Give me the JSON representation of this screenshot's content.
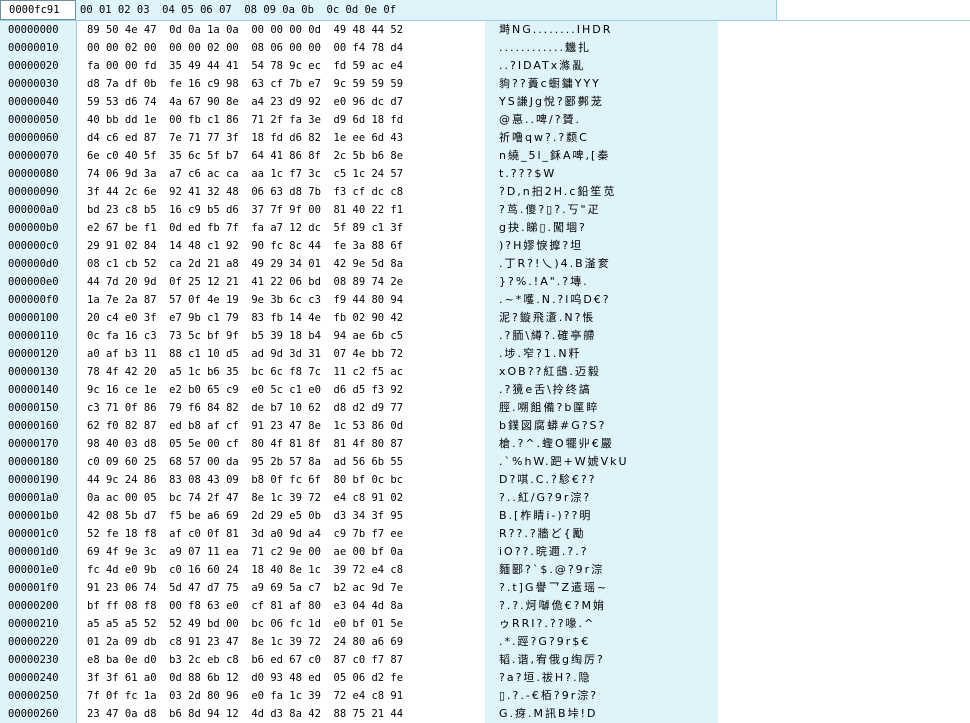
{
  "header": {
    "address": "0000fc91",
    "columns": "00 01 02 03  04 05 06 07  08 09 0a 0b  0c 0d 0e 0f"
  },
  "rows": [
    {
      "offset": "00000000",
      "hex": "89 50 4e 47  0d 0a 1a 0a  00 00 00 0d  49 48 44 52",
      "text": "塒NG........IHDR"
    },
    {
      "offset": "00000010",
      "hex": "00 00 02 00  00 00 02 00  08 06 00 00  00 f4 78 d4",
      "text": "............魕扎"
    },
    {
      "offset": "00000020",
      "hex": "fa 00 00 fd  35 49 44 41  54 78 9c ec  fd 59 ac e4",
      "text": "..?IDATx滌亂"
    },
    {
      "offset": "00000030",
      "hex": "d8 7a df 0b  fe 16 c9 98  63 cf 7b e7  9c 59 59 59",
      "text": "豿??蕢c蟵鏞YYY"
    },
    {
      "offset": "00000040",
      "hex": "59 53 d6 74  4a 67 90 8e  a4 23 d9 92  e0 96 dc d7",
      "text": "YS謙Jg悅?郾鄸茏"
    },
    {
      "offset": "00000050",
      "hex": "40 bb dd 1e  00 fb c1 86  71 2f fa 3e  d9 6d 18 fd",
      "text": "@惪..啤/?贇."
    },
    {
      "offset": "00000060",
      "hex": "d4 c6 ed 87  7e 71 77 3f  18 fd d6 82  1e ee 6d 43",
      "text": "祈噜qw?.?颣C"
    },
    {
      "offset": "00000070",
      "hex": "6e c0 40 5f  35 6c 5f b7  64 41 86 8f  2c 5b b6 8e",
      "text": "n繞_5l_鉌A啤,[秦"
    },
    {
      "offset": "00000080",
      "hex": "74 06 9d 3a  a7 c6 ac ca  aa 1c f7 3c  c5 1c 24 57",
      "text": "t.???$W"
    },
    {
      "offset": "00000090",
      "hex": "3f 44 2c 6e  92 41 32 48  06 63 d8 7b  f3 cf dc c8",
      "text": "?D,n抇2H.c鉛笙苋"
    },
    {
      "offset": "000000a0",
      "hex": "bd 23 c8 b5  16 c9 b5 d6  37 7f 9f 00  81 40 22 f1",
      "text": "?茑.傻?▯?.丂\"疋"
    },
    {
      "offset": "000000b0",
      "hex": "e2 67 be f1  0d ed fb 7f  fa a7 12 dc  5f 89 c1 3f",
      "text": "g抉.睇▯.闖堌?"
    },
    {
      "offset": "000000c0",
      "hex": "29 91 02 84  14 48 c1 92  90 fc 8c 44  fe 3a 88 6f",
      "text": ")?H嫪悷擵?坦"
    },
    {
      "offset": "000000d0",
      "hex": "08 c1 cb 52  ca 2d 21 a8  49 29 34 01  42 9e 5d 8a",
      "text": ".丁R?!乀)4.B滏奒"
    },
    {
      "offset": "000000e0",
      "hex": "44 7d 20 9d  0f 25 12 21  41 22 06 bd  08 89 74 2e",
      "text": "}?%.!A\".?塼."
    },
    {
      "offset": "000000f0",
      "hex": "1a 7e 2a 87  57 0f 4e 19  9e 3b 6c c3  f9 44 80 94",
      "text": ".~*嚄.N.?l呜D€?"
    },
    {
      "offset": "00000100",
      "hex": "20 c4 e0 3f  e7 9b c1 79  83 fb 14 4e  fb 02 90 42",
      "text": "泥?鏇飛濸.N?悵"
    },
    {
      "offset": "00000110",
      "hex": "0c fa 16 c3  73 5c bf 9f  b5 39 18 b4  94 ae 6b c5",
      "text": ".?胹\\繜?.確亭艜"
    },
    {
      "offset": "00000120",
      "hex": "a0 af b3 11  88 c1 10 d5  ad 9d 3d 31  07 4e bb 72",
      "text": ".埗.窄?1.N粁"
    },
    {
      "offset": "00000130",
      "hex": "78 4f 42 20  a5 1c b6 35  bc 6c f8 7c  11 c2 f5 ac",
      "text": "xOB??紅鴟.迈毅"
    },
    {
      "offset": "00000140",
      "hex": "9c 16 ce 1e  e2 b0 65 c9  e0 5c c1 e0  d6 d5 f3 92",
      "text": ".?獍e舌\\拎终謞"
    },
    {
      "offset": "00000150",
      "hex": "c3 71 0f 86  79 f6 84 82  de b7 10 62  d8 d2 d9 77",
      "text": "脛.嗍飷備?b匰睟"
    },
    {
      "offset": "00000160",
      "hex": "62 f0 82 87  ed b8 af cf  91 23 47 8e  1c 53 86 0d",
      "text": "b鏷図腐蟒#G?S?"
    },
    {
      "offset": "00000170",
      "hex": "98 40 03 d8  05 5e 00 cf  80 4f 81 8f  81 4f 80 87",
      "text": "槍.?^.蟶O犤丱€嚴"
    },
    {
      "offset": "00000180",
      "hex": "c0 09 60 25  68 57 00 da  95 2b 57 8a  ad 56 6b 55",
      "text": ".`%hW.跁+W婋VkU"
    },
    {
      "offset": "00000190",
      "hex": "44 9c 24 86  83 08 43 09  b8 0f fc 6f  80 bf 0c bc",
      "text": "D?唭.C.?駗€??"
    },
    {
      "offset": "000001a0",
      "hex": "0a ac 00 05  bc 74 2f 47  8e 1c 39 72  e4 c8 91 02",
      "text": "?..紅/G?9r淙?"
    },
    {
      "offset": "000001b0",
      "hex": "42 08 5b d7  f5 be a6 69  2d 29 e5 0b  d3 34 3f 95",
      "text": "B.[柞睛i-)??明"
    },
    {
      "offset": "000001c0",
      "hex": "52 fe 18 f8  af c0 0f 81  3d a0 9d a4  c9 7b f7 ee",
      "text": "R??.?牆ど{勵"
    },
    {
      "offset": "000001d0",
      "hex": "69 4f 9e 3c  a9 07 11 ea  71 c2 9e 00  ae 00 bf 0a",
      "text": "iO??.晥邇.?.?"
    },
    {
      "offset": "000001e0",
      "hex": "fc 4d e0 9b  c0 16 60 24  18 40 8e 1c  39 72 e4 c8",
      "text": "麵郾?`$.@?9r淙"
    },
    {
      "offset": "000001f0",
      "hex": "91 23 06 74  5d 47 d7 75  a9 69 5a c7  b2 ac 9d 7e",
      "text": "?.t]G譽乛Z遣瑶~"
    },
    {
      "offset": "00000200",
      "hex": "bf ff 08 f8  00 f8 63 e0  cf 81 af 80  e3 04 4d 8a",
      "text": "?.?.炣嚹佹€?M姢"
    },
    {
      "offset": "00000210",
      "hex": "a5 a5 a5 52  52 49 bd 00  bc 06 fc 1d  e0 bf 01 5e",
      "text": "ゥRRI?.??喙.^"
    },
    {
      "offset": "00000220",
      "01 2a 09 db": "",
      "offset2": "",
      "hex": "01 2a 09 db  c8 91 23 47  8e 1c 39 72  24 80 a6 69",
      "text": ".*.踁?G?9r$€"
    },
    {
      "offset": "00000230",
      "hex": "e8 ba 0e d0  b3 2c eb c8  b6 ed 67 c0  87 c0 f7 87",
      "text": "韬.谐,宥俄g绹厉?"
    },
    {
      "offset": "00000240",
      "hex": "3f 3f 61 a0  0d 88 6b 12  d0 93 48 ed  05 06 d2 fe",
      "text": "?a?垣.祓H?.隐"
    },
    {
      "offset": "00000250",
      "hex": "7f 0f fc 1a  03 2d 80 96  e0 fa 1c 39  72 e4 c8 91",
      "text": "▯.?.-€栢?9r淙?"
    },
    {
      "offset": "00000260",
      "hex": "23 47 0a d8  b6 8d 94 12  4d d3 8a 42  88 75 21 44",
      "text": "G.疨.M訊B垰!D"
    }
  ]
}
